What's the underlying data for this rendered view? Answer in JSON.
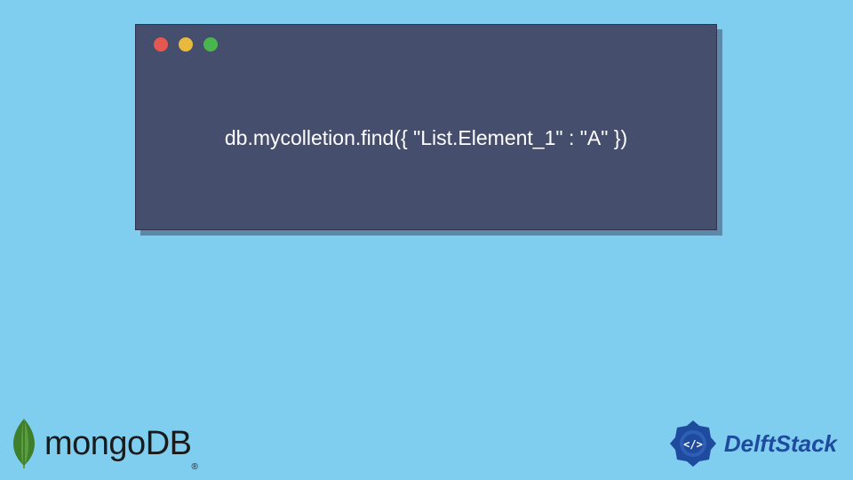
{
  "code_window": {
    "code": "db.mycolletion.find({ \"List.Element_1\" : \"A\" })",
    "dots": {
      "red": "#e45851",
      "yellow": "#e7b93c",
      "green": "#4ab54d"
    }
  },
  "footer": {
    "mongo": {
      "text": "mongoDB",
      "registered": "®"
    },
    "delft": {
      "text": "DelftStack"
    }
  },
  "colors": {
    "background": "#7fcef0",
    "window_bg": "#464e6e",
    "delft_blue": "#1e4b9e"
  }
}
